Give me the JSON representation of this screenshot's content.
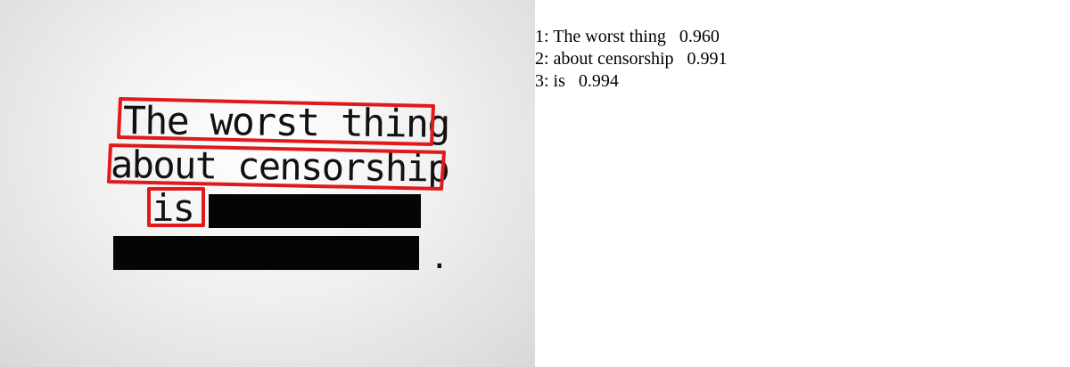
{
  "image": {
    "lines": [
      "The worst thing",
      "about censorship",
      "is"
    ],
    "period": ".",
    "box_color": "#e01a1a",
    "redaction_color": "#050505"
  },
  "results": [
    {
      "label": "1: The worst thing   0.960",
      "text": "The worst thing",
      "score": "0.960"
    },
    {
      "label": "2: about censorship   0.991",
      "text": "about censorship",
      "score": "0.991"
    },
    {
      "label": "3: is   0.994",
      "text": "is",
      "score": "0.994"
    }
  ]
}
